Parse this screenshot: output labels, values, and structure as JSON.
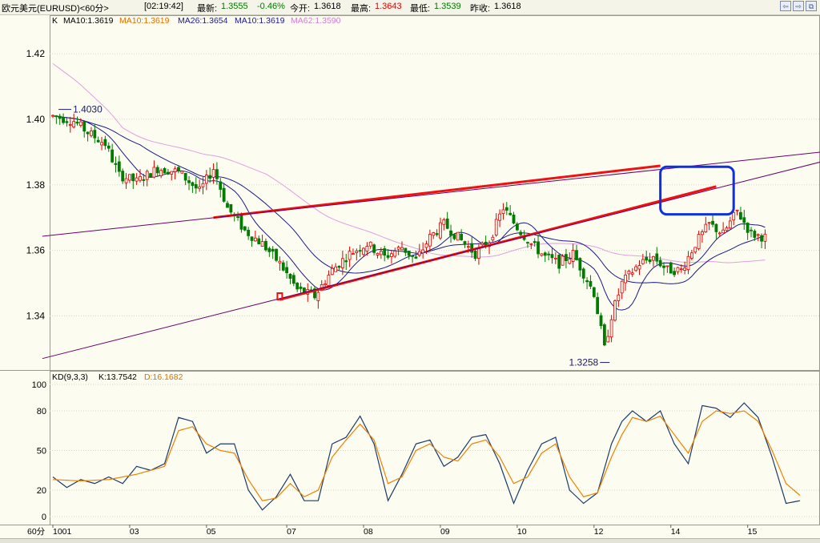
{
  "header": {
    "symbol": "欧元美元(EURUSD)<60分>",
    "time": "[02:19:42]",
    "latest_label": "最新:",
    "latest_value": "1.3555",
    "change_value": "-0.46%",
    "open_label": "今开:",
    "open_value": "1.3618",
    "high_label": "最高:",
    "high_value": "1.3643",
    "low_label": "最低:",
    "low_value": "1.3539",
    "prev_close_label": "昨收:",
    "prev_close_value": "1.3618",
    "window_buttons": [
      {
        "name": "back-icon",
        "glyph": "⇦"
      },
      {
        "name": "forward-icon",
        "glyph": "⇨"
      },
      {
        "name": "restore-icon",
        "glyph": "⧉"
      }
    ]
  },
  "colors": {
    "up_candle": "#e00000",
    "down_candle": "#007a00",
    "ma10": "#1a1a8a",
    "ma26": "#7a007a",
    "ma62": "#e0a0e0",
    "k_line": "#1a3a6a",
    "d_line": "#f08000",
    "trend_red": "#f01010",
    "trend_purple": "#6a006a",
    "highlight_box": "#1030e0"
  },
  "chart_data": [
    {
      "type": "candlestick",
      "series_name": "K",
      "legend": [
        {
          "text": "K",
          "color": "#000000"
        },
        {
          "text": "MA10:1.3619",
          "color": "#000000"
        },
        {
          "text": "MA10:1.3619",
          "color": "#e07000"
        },
        {
          "text": "MA26:1.3654",
          "color": "#1a1a8a"
        },
        {
          "text": "MA10:1.3619",
          "color": "#1a1a8a"
        },
        {
          "text": "MA62:1.3590",
          "color": "#d080d0"
        }
      ],
      "y_ticks": [
        "1.42",
        "1.40",
        "1.38",
        "1.36",
        "1.34"
      ],
      "y_tick_values": [
        1.42,
        1.4,
        1.38,
        1.36,
        1.34
      ],
      "ylim": [
        1.3235,
        1.4315
      ],
      "x_ticks": [
        "1001",
        "03",
        "05",
        "07",
        "08",
        "09",
        "10",
        "12",
        "14",
        "15"
      ],
      "x_tick_bars": [
        0,
        22,
        44,
        67,
        89,
        111,
        133,
        155,
        177,
        199
      ],
      "bar_count": 205,
      "grid": true,
      "anchors": [
        [
          0,
          1.401
        ],
        [
          6,
          1.3995
        ],
        [
          10,
          1.396
        ],
        [
          15,
          1.3925
        ],
        [
          19,
          1.383
        ],
        [
          24,
          1.381
        ],
        [
          30,
          1.385
        ],
        [
          36,
          1.384
        ],
        [
          42,
          1.378
        ],
        [
          46,
          1.385
        ],
        [
          50,
          1.373
        ],
        [
          55,
          1.366
        ],
        [
          60,
          1.362
        ],
        [
          65,
          1.356
        ],
        [
          70,
          1.348
        ],
        [
          75,
          1.346
        ],
        [
          80,
          1.354
        ],
        [
          85,
          1.359
        ],
        [
          90,
          1.362
        ],
        [
          95,
          1.358
        ],
        [
          100,
          1.361
        ],
        [
          104,
          1.357
        ],
        [
          108,
          1.364
        ],
        [
          112,
          1.368
        ],
        [
          117,
          1.363
        ],
        [
          121,
          1.359
        ],
        [
          125,
          1.363
        ],
        [
          129,
          1.373
        ],
        [
          133,
          1.367
        ],
        [
          137,
          1.362
        ],
        [
          141,
          1.358
        ],
        [
          145,
          1.356
        ],
        [
          149,
          1.359
        ],
        [
          152,
          1.353
        ],
        [
          155,
          1.347
        ],
        [
          158,
          1.33
        ],
        [
          160,
          1.34
        ],
        [
          163,
          1.35
        ],
        [
          168,
          1.356
        ],
        [
          172,
          1.358
        ],
        [
          176,
          1.354
        ],
        [
          180,
          1.354
        ],
        [
          184,
          1.362
        ],
        [
          188,
          1.368
        ],
        [
          192,
          1.365
        ],
        [
          196,
          1.372
        ],
        [
          200,
          1.365
        ],
        [
          204,
          1.364
        ],
        [
          207,
          1.36
        ],
        [
          210,
          1.356
        ]
      ],
      "annotations": [
        {
          "text": "1.4030",
          "bar": 3,
          "price": 1.403
        },
        {
          "text": "1.3258",
          "bar": 159,
          "price": 1.3258
        }
      ],
      "trend_lines": [
        {
          "color": "red",
          "from": [
            46,
            1.37
          ],
          "to": [
            174,
            1.3858
          ]
        },
        {
          "color": "red",
          "from": [
            65,
            1.345
          ],
          "to": [
            190,
            1.3795
          ]
        },
        {
          "color": "purple",
          "from": [
            -3,
            1.3643
          ],
          "to": [
            220,
            1.39
          ]
        },
        {
          "color": "purple",
          "from": [
            -3,
            1.327
          ],
          "to": [
            220,
            1.387
          ]
        }
      ],
      "highlight_box": {
        "from": [
          174,
          1.3855
        ],
        "to": [
          195,
          1.371
        ]
      }
    },
    {
      "type": "line",
      "title": "KD(9,3,3)",
      "legend": [
        {
          "text": "KD(9,3,3)",
          "color": "#000000"
        },
        {
          "text": "K:13.7542",
          "color": "#000000"
        },
        {
          "text": "D:16.1682",
          "color": "#e07000"
        }
      ],
      "y_ticks": [
        "100",
        "80",
        "50",
        "20",
        "0"
      ],
      "y_tick_values": [
        100,
        80,
        50,
        20,
        0
      ],
      "ylim": [
        0,
        100
      ],
      "series": [
        {
          "name": "K",
          "anchors": [
            [
              0,
              30
            ],
            [
              4,
              22
            ],
            [
              8,
              28
            ],
            [
              12,
              25
            ],
            [
              16,
              30
            ],
            [
              20,
              25
            ],
            [
              24,
              38
            ],
            [
              28,
              35
            ],
            [
              32,
              40
            ],
            [
              36,
              75
            ],
            [
              40,
              72
            ],
            [
              44,
              48
            ],
            [
              48,
              55
            ],
            [
              52,
              55
            ],
            [
              56,
              20
            ],
            [
              60,
              5
            ],
            [
              64,
              15
            ],
            [
              68,
              32
            ],
            [
              72,
              12
            ],
            [
              76,
              12
            ],
            [
              80,
              55
            ],
            [
              84,
              60
            ],
            [
              88,
              76
            ],
            [
              92,
              55
            ],
            [
              96,
              12
            ],
            [
              100,
              32
            ],
            [
              104,
              55
            ],
            [
              108,
              58
            ],
            [
              112,
              38
            ],
            [
              116,
              45
            ],
            [
              120,
              60
            ],
            [
              124,
              62
            ],
            [
              128,
              40
            ],
            [
              132,
              10
            ],
            [
              136,
              35
            ],
            [
              140,
              55
            ],
            [
              144,
              60
            ],
            [
              148,
              20
            ],
            [
              152,
              10
            ],
            [
              156,
              18
            ],
            [
              160,
              55
            ],
            [
              163,
              72
            ],
            [
              166,
              80
            ],
            [
              170,
              72
            ],
            [
              174,
              80
            ],
            [
              178,
              55
            ],
            [
              182,
              40
            ],
            [
              186,
              84
            ],
            [
              190,
              82
            ],
            [
              194,
              75
            ],
            [
              198,
              86
            ],
            [
              202,
              75
            ],
            [
              206,
              45
            ],
            [
              210,
              10
            ],
            [
              214,
              12
            ]
          ]
        },
        {
          "name": "D",
          "anchors": [
            [
              0,
              28
            ],
            [
              8,
              27
            ],
            [
              16,
              28
            ],
            [
              24,
              32
            ],
            [
              32,
              38
            ],
            [
              36,
              65
            ],
            [
              40,
              68
            ],
            [
              44,
              55
            ],
            [
              48,
              50
            ],
            [
              52,
              48
            ],
            [
              56,
              28
            ],
            [
              60,
              12
            ],
            [
              64,
              14
            ],
            [
              68,
              25
            ],
            [
              72,
              15
            ],
            [
              76,
              20
            ],
            [
              80,
              45
            ],
            [
              84,
              58
            ],
            [
              88,
              70
            ],
            [
              92,
              58
            ],
            [
              96,
              25
            ],
            [
              100,
              30
            ],
            [
              104,
              50
            ],
            [
              108,
              55
            ],
            [
              112,
              45
            ],
            [
              116,
              42
            ],
            [
              120,
              55
            ],
            [
              124,
              58
            ],
            [
              128,
              45
            ],
            [
              132,
              25
            ],
            [
              136,
              30
            ],
            [
              140,
              48
            ],
            [
              144,
              55
            ],
            [
              148,
              30
            ],
            [
              152,
              15
            ],
            [
              156,
              18
            ],
            [
              160,
              45
            ],
            [
              163,
              62
            ],
            [
              166,
              75
            ],
            [
              170,
              72
            ],
            [
              174,
              76
            ],
            [
              178,
              62
            ],
            [
              182,
              48
            ],
            [
              186,
              72
            ],
            [
              190,
              80
            ],
            [
              194,
              78
            ],
            [
              198,
              80
            ],
            [
              202,
              72
            ],
            [
              206,
              50
            ],
            [
              210,
              25
            ],
            [
              214,
              16
            ]
          ]
        }
      ]
    }
  ],
  "footer": {
    "period_label": "60分"
  }
}
